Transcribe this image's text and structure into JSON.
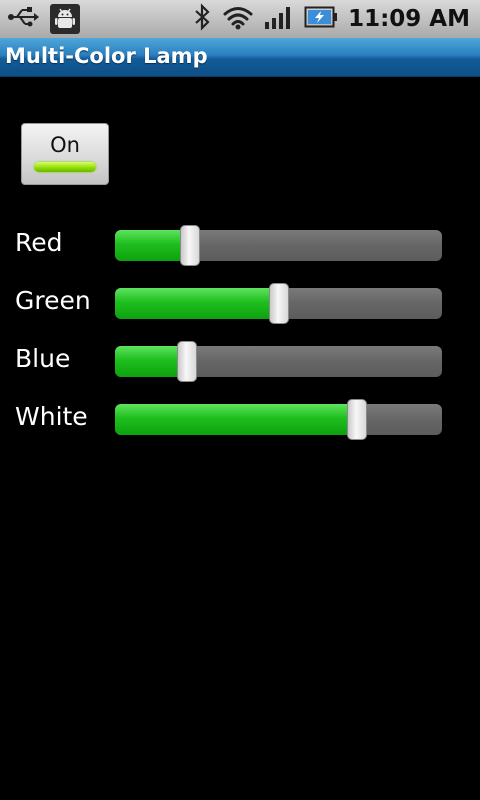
{
  "status_bar": {
    "time": "11:09 AM",
    "icons": [
      "usb-icon",
      "android-debug-icon",
      "bluetooth-icon",
      "wifi-icon",
      "signal-icon",
      "battery-charging-icon"
    ]
  },
  "app": {
    "title": "Multi-Color Lamp"
  },
  "power_toggle": {
    "label": "On",
    "state": true,
    "indicator_color": "#8fdc00"
  },
  "sliders": [
    {
      "label": "Red",
      "value_percent": 23
    },
    {
      "label": "Green",
      "value_percent": 50
    },
    {
      "label": "Blue",
      "value_percent": 22
    },
    {
      "label": "White",
      "value_percent": 74
    }
  ],
  "colors": {
    "fill": "#1fbf1f",
    "track": "#666666",
    "title_bar": "#135c99"
  }
}
